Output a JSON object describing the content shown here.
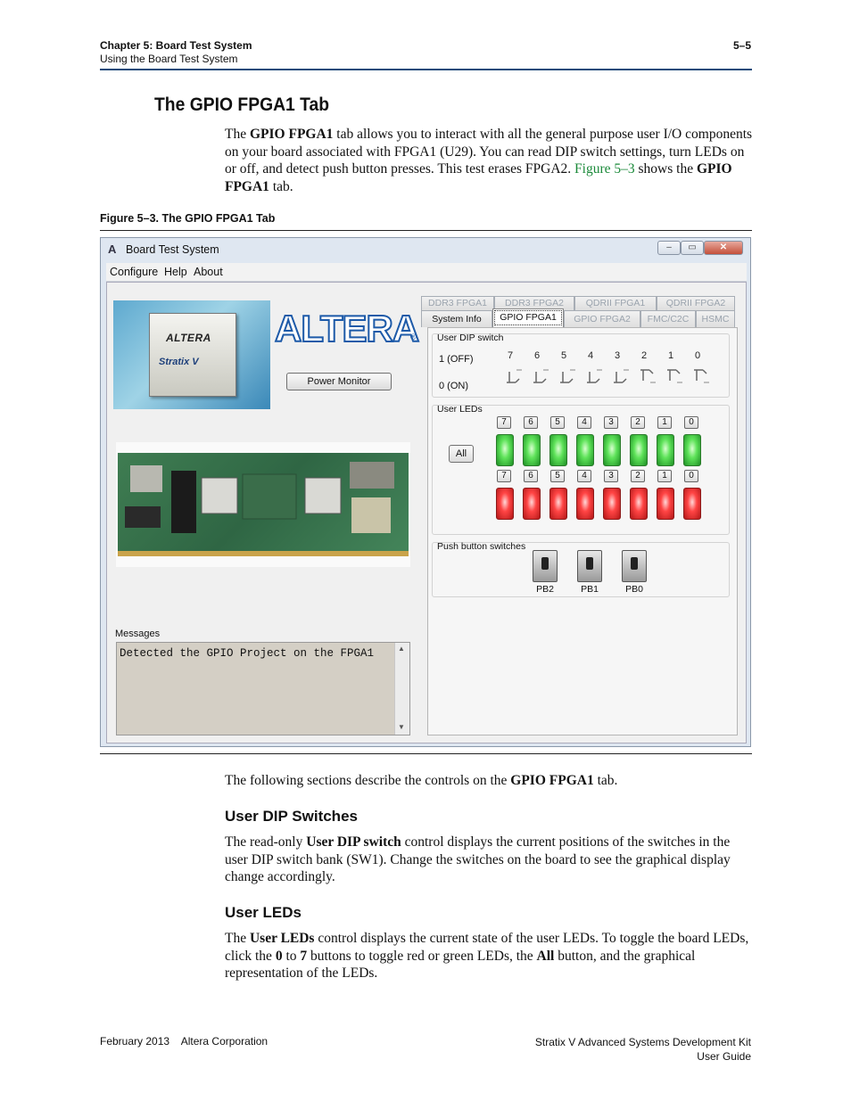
{
  "header": {
    "chapter": "Chapter 5: Board Test System",
    "section": "Using the Board Test System",
    "page": "5–5"
  },
  "heading": "The GPIO FPGA1 Tab",
  "intro": {
    "p1_a": "The ",
    "p1_b": "GPIO FPGA1",
    "p1_c": " tab allows you to interact with all the general purpose user I/O components on your board associated with FPGA1 (U29). You can read DIP switch settings, turn LEDs on or off, and detect push button presses. This test erases FPGA2. ",
    "p1_link": "Figure 5–3",
    "p1_d": " shows the ",
    "p1_e": "GPIO FPGA1",
    "p1_f": " tab."
  },
  "figure_caption": "Figure 5–3.  The GPIO FPGA1 Tab",
  "window": {
    "title": "Board Test System",
    "app_icon": "A",
    "menu": [
      "Configure",
      "Help",
      "About"
    ],
    "chip_brand": "ALTERA",
    "chip_family": "Stratix V",
    "logo": "ALTERA",
    "logo_mark": "®",
    "power_monitor": "Power Monitor",
    "messages_label": "Messages",
    "message_text": "Detected the GPIO Project on the FPGA1",
    "tabs_row1": [
      "DDR3 FPGA1",
      "DDR3 FPGA2",
      "QDRII FPGA1",
      "QDRII FPGA2"
    ],
    "tabs_row2": [
      "System Info",
      "GPIO FPGA1",
      "GPIO FPGA2",
      "FMC/C2C",
      "HSMC"
    ],
    "active_tab": "GPIO FPGA1",
    "dip": {
      "label": "User DIP switch",
      "numbers": [
        "7",
        "6",
        "5",
        "4",
        "3",
        "2",
        "1",
        "0"
      ],
      "off_label": "1 (OFF)",
      "on_label": "0 (ON)",
      "states": [
        0,
        0,
        0,
        0,
        0,
        1,
        1,
        1
      ]
    },
    "leds": {
      "label": "User LEDs",
      "all_button": "All",
      "numbers": [
        "7",
        "6",
        "5",
        "4",
        "3",
        "2",
        "1",
        "0"
      ]
    },
    "push": {
      "label": "Push button switches",
      "buttons": [
        "PB2",
        "PB1",
        "PB0"
      ]
    }
  },
  "after_figure": {
    "p_a": "The following sections describe the controls on the ",
    "p_b": "GPIO FPGA1",
    "p_c": " tab."
  },
  "dip_section": {
    "title": "User DIP Switches",
    "a": "The read-only ",
    "b": "User DIP switch",
    "c": " control displays the current positions of the switches in the user DIP switch bank (SW1). Change the switches on the board to see the graphical display change accordingly."
  },
  "led_section": {
    "title": "User LEDs",
    "a": "The ",
    "b": "User LEDs",
    "c": " control displays the current state of the user LEDs. To toggle the board LEDs, click the ",
    "d": "0",
    "e": " to ",
    "f": "7",
    "g": " buttons to toggle red or green LEDs, the ",
    "h": "All",
    "i": " button, and the graphical representation of the LEDs."
  },
  "footer": {
    "left": "February 2013    Altera Corporation",
    "right1": "Stratix V Advanced Systems Development Kit",
    "right2": "User Guide"
  }
}
